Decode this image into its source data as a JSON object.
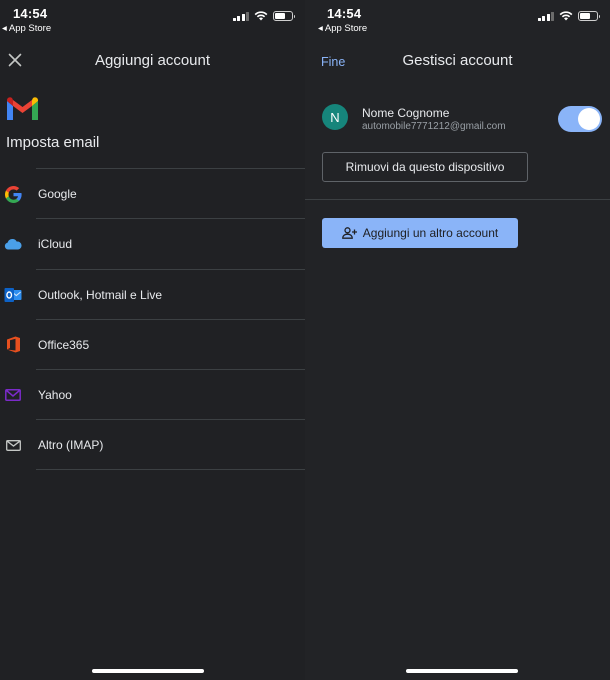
{
  "left_screen": {
    "status_bar": {
      "time": "14:54",
      "back_app": "◂ App Store"
    },
    "header": {
      "title": "Aggiungi account",
      "close_icon": "close-icon"
    },
    "setup_title": "Imposta email",
    "providers": [
      {
        "label": "Google",
        "icon": "google-icon"
      },
      {
        "label": "iCloud",
        "icon": "icloud-icon"
      },
      {
        "label": "Outlook, Hotmail e Live",
        "icon": "outlook-icon"
      },
      {
        "label": "Office365",
        "icon": "office365-icon"
      },
      {
        "label": "Yahoo",
        "icon": "yahoo-icon"
      },
      {
        "label": "Altro (IMAP)",
        "icon": "mail-icon"
      }
    ]
  },
  "right_screen": {
    "status_bar": {
      "time": "14:54",
      "back_app": "◂ App Store"
    },
    "header": {
      "done_label": "Fine",
      "title": "Gestisci account"
    },
    "account": {
      "avatar_letter": "N",
      "name": "Nome Cognome",
      "email": "automobile7771212@gmail.com",
      "sync_enabled": true
    },
    "remove_button": "Rimuovi da questo dispositivo",
    "add_button": "Aggiungi un altro account"
  },
  "colors": {
    "background": "#202124",
    "accent": "#8ab4f8",
    "avatar": "#16857b",
    "divider": "#3c4043"
  }
}
